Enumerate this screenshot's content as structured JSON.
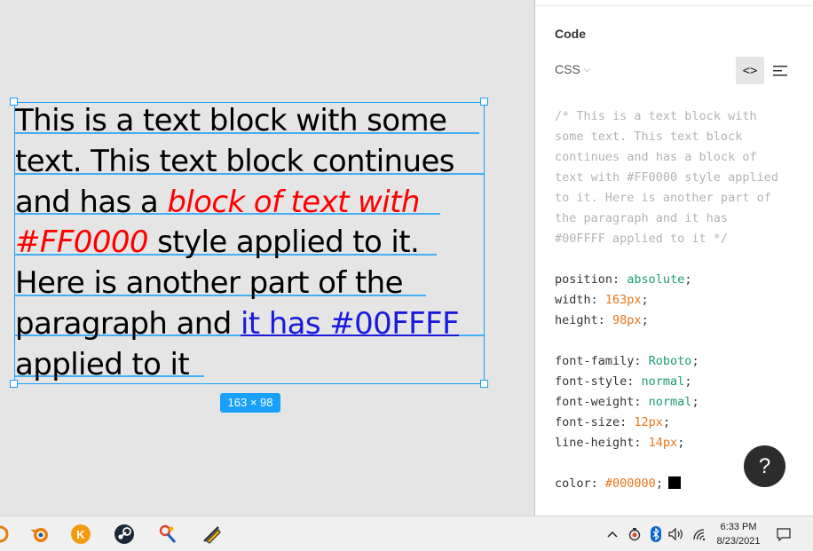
{
  "canvas": {
    "text_segments": [
      {
        "text": "This is a text block with some text. This text block continues and has a ",
        "style": "normal"
      },
      {
        "text": "block of text with #FF0000",
        "style": "red"
      },
      {
        "text": " style applied to it. Here is another part of the paragraph and ",
        "style": "normal"
      },
      {
        "text": "it has #00FFFF",
        "style": "blue"
      },
      {
        "text": " applied to it",
        "style": "normal"
      }
    ],
    "size_badge": "163 × 98",
    "colors": {
      "selection": "#18a0fb",
      "red_text": "#ff0000",
      "blue_text": "#1a1adb"
    }
  },
  "panel": {
    "title": "Code",
    "language": "CSS",
    "code_view_icon": "code-brackets-icon",
    "list_view_icon": "text-lines-icon",
    "comment_lines": [
      "/* This is a text block with",
      "some text. This text block",
      "continues and has a block of",
      "text with #FF0000 style applied",
      "to it. Here is another part of",
      "the paragraph and it has",
      "#00FFFF applied to it */"
    ],
    "layout_props": [
      {
        "prop": "position",
        "value": "absolute",
        "kind": "green"
      },
      {
        "prop": "width",
        "value": "163px",
        "kind": "orange"
      },
      {
        "prop": "height",
        "value": "98px",
        "kind": "orange"
      }
    ],
    "font_props": [
      {
        "prop": "font-family",
        "value": "Roboto",
        "kind": "green"
      },
      {
        "prop": "font-style",
        "value": "normal",
        "kind": "green"
      },
      {
        "prop": "font-weight",
        "value": "normal",
        "kind": "green"
      },
      {
        "prop": "font-size",
        "value": "12px",
        "kind": "orange"
      },
      {
        "prop": "line-height",
        "value": "14px",
        "kind": "orange"
      }
    ],
    "color_prop": {
      "prop": "color",
      "value": "#000000",
      "swatch": "#000000"
    },
    "help_label": "?"
  },
  "taskbar": {
    "apps": [
      "blender-icon",
      "k-app-icon",
      "steam-icon",
      "tool-app-icon",
      "inkscape-icon"
    ],
    "tray": [
      "chevron-up-icon",
      "shield-icon",
      "bluetooth-icon",
      "volume-icon",
      "wifi-icon"
    ],
    "time": "6:33 PM",
    "date": "8/23/2021",
    "notification_icon": "notification-icon"
  }
}
